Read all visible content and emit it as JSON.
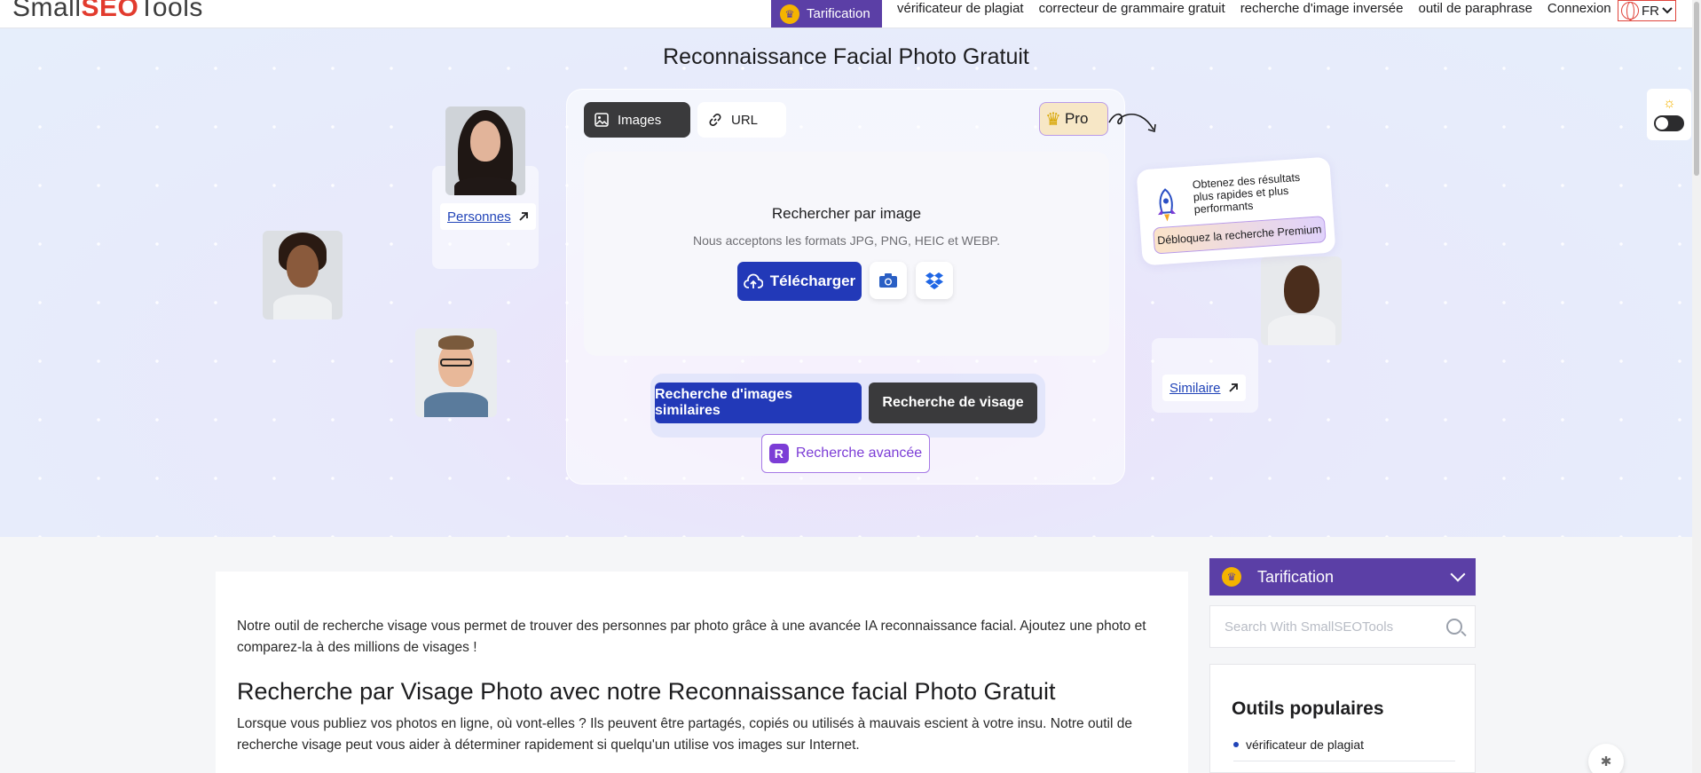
{
  "nav": {
    "logo_small": "Small",
    "logo_seo": "SEO",
    "logo_tools": "Tools",
    "pricing": "Tarification",
    "links": [
      "vérificateur de plagiat",
      "correcteur de grammaire gratuit",
      "recherche d'image inversée",
      "outil de paraphrase",
      "Connexion"
    ],
    "lang": "FR"
  },
  "hero": {
    "title": "Reconnaissance Facial Photo Gratuit",
    "tabs": [
      "Images",
      "URL"
    ],
    "pro_label": "Pro",
    "drop_title": "Rechercher par image",
    "drop_sub": "Nous acceptons les formats JPG, PNG, HEIC et WEBP.",
    "upload_label": "Télécharger",
    "similar_label": "Recherche d'images similaires",
    "face_label": "Recherche de visage",
    "advanced_label": "Recherche avancée",
    "persons_link": "Personnes",
    "similar_link": "Similaire",
    "promo_text": "Obtenez des résultats plus rapides et plus performants",
    "promo_button": "Débloquez la recherche Premium"
  },
  "content": {
    "intro": "Notre outil de recherche visage vous permet de trouver des personnes par photo grâce à une avancée IA reconnaissance facial. Ajoutez une photo et comparez-la à des millions de visages !",
    "heading": "Recherche par Visage Photo avec notre Reconnaissance facial Photo Gratuit",
    "paragraph": "Lorsque vous publiez vos photos en ligne, où vont-elles ? Ils peuvent être partagés, copiés ou utilisés à mauvais escient à votre insu. Notre outil de recherche visage peut vous aider à déterminer rapidement si quelqu'un utilise vos images sur Internet."
  },
  "sidebar": {
    "pricing": "Tarification",
    "search_placeholder": "Search With SmallSEOTools",
    "popular_title": "Outils populaires",
    "popular_items": [
      "vérificateur de plagiat"
    ]
  },
  "colors": {
    "brand_purple": "#5b3fa6",
    "primary_blue": "#2239b8",
    "dark_button": "#3a3a3c",
    "accent_violet": "#7c3dd6"
  }
}
